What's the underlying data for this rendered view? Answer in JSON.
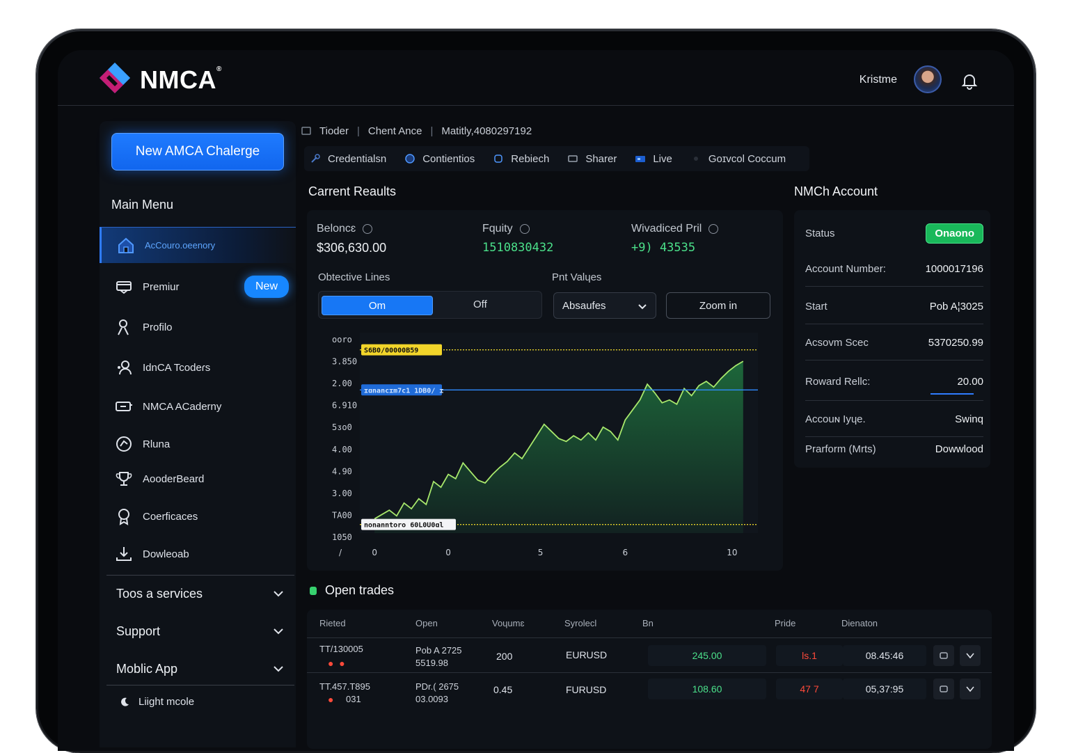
{
  "header": {
    "brand": "NMCA",
    "user_name": "Kristme"
  },
  "sidebar": {
    "new_button": "New AMCA Chalerge",
    "main_menu_title": "Main Menu",
    "items": [
      {
        "label": "AcCouro.oeenory",
        "icon": "home-icon"
      },
      {
        "label": "Premiur",
        "icon": "card-icon",
        "badge": "New"
      },
      {
        "label": "Profilo",
        "icon": "user-icon"
      },
      {
        "label": "IdnCA Tcodeɾs",
        "icon": "users-icon"
      },
      {
        "label": "NMCA ACaderny",
        "icon": "academy-icon"
      },
      {
        "label": "Rluna",
        "icon": "rules-icon"
      },
      {
        "label": "AooderBeard",
        "icon": "trophy-icon"
      },
      {
        "label": "Coerficaces",
        "icon": "certificate-icon"
      },
      {
        "label": "Dowleoab",
        "icon": "download-icon"
      }
    ],
    "sections": [
      "Toos a services",
      "Support",
      "Moblic App"
    ],
    "light_mode": "Liight mcole"
  },
  "breadcrumb": [
    "Tioder",
    "Chent Ance",
    "Matitly,4080297192"
  ],
  "tabs": [
    "Credentialsn",
    "Contientios",
    "Rebiech",
    "Sharer",
    "Live",
    "Goɪvcol Coccum"
  ],
  "results": {
    "title": "Carrent Reaults",
    "balance_label": "Beloncɛ",
    "balance_value": "$306,630.00",
    "equity_label": "Fquity",
    "equity_value": "1510830432",
    "unrealized_label": "Wivadiced Pril",
    "unrealized_value": "+9) 43535",
    "objective_label": "Obtective Lines",
    "toggle_on": "Om",
    "toggle_off": "Off",
    "pnt_label": "Pnt Valɥes",
    "select_value": "Absaufes",
    "zoom_label": "Zoom in"
  },
  "chart_data": {
    "type": "area",
    "title": "",
    "y_ticks": [
      "ooro",
      "3.850",
      "2.00",
      "6.910",
      "5ᴣo0",
      "4.00",
      "4.90",
      "3.00",
      "TA00",
      "1050"
    ],
    "x_ticks": [
      "0",
      "0",
      "5",
      "6",
      "10"
    ],
    "x_leading_label": "/",
    "x": [
      0,
      0.4,
      0.6,
      0.8,
      1.0,
      1.2,
      1.4,
      1.6,
      1.8,
      2.0,
      2.2,
      2.4,
      2.6,
      2.8,
      3.0,
      3.2,
      3.4,
      3.6,
      3.8,
      4.0,
      4.2,
      4.4,
      4.6,
      4.8,
      5.0,
      5.2,
      5.4,
      5.6,
      5.8,
      6.0,
      6.2,
      6.4,
      6.6,
      6.8,
      7.0,
      7.2,
      7.4,
      7.6,
      7.8,
      8.0,
      8.2,
      8.4,
      8.6,
      8.8,
      9.0,
      9.2,
      9.4,
      9.6,
      9.8,
      10.0
    ],
    "values": [
      1.0,
      1.6,
      1.2,
      2.1,
      1.7,
      2.4,
      2.0,
      3.6,
      3.2,
      4.1,
      3.8,
      4.9,
      4.3,
      3.7,
      3.5,
      4.1,
      4.6,
      5.0,
      5.6,
      5.2,
      6.0,
      6.8,
      7.6,
      7.1,
      6.6,
      6.4,
      6.8,
      6.5,
      7.0,
      6.5,
      7.4,
      7.1,
      6.5,
      7.9,
      8.6,
      9.3,
      10.4,
      9.8,
      9.1,
      9.3,
      9.0,
      10.1,
      9.6,
      10.3,
      10.6,
      10.2,
      10.8,
      11.3,
      11.7,
      12.0
    ],
    "y_range": [
      0,
      14
    ],
    "x_range": [
      -0.4,
      10.4
    ],
    "ref_lines": [
      {
        "value": 12.8,
        "color": "#e8d22a",
        "label": "S6B0/00000B59"
      },
      {
        "value": 10.0,
        "color": "#2f8cff",
        "label": "ɪɑnancɪm7c1 1DB0/ ɪ"
      },
      {
        "value": 0.6,
        "color": "#e8d22a",
        "label": "nonanntoro 60L0U0ɑl"
      }
    ],
    "line_color": "#a8e86c",
    "fill_color": "#1e6b3c"
  },
  "account": {
    "title": "NMCh Account",
    "rows": [
      {
        "label": "Status",
        "value": "Onaono",
        "pill": true
      },
      {
        "label": "Account Number:",
        "value": "1000017196"
      },
      {
        "label": "Start",
        "value": "Pob A¦3025"
      },
      {
        "label": "Acsovm Scec",
        "value": "5370250.99"
      },
      {
        "label": "Roward Rellc:",
        "value": "20.00"
      },
      {
        "label": "Accouɴ Iyɥe.",
        "value": "Swinq"
      },
      {
        "label": "Prarform (Mrts)",
        "value": "Dowwlood"
      }
    ]
  },
  "trades": {
    "title": "Open trades",
    "columns": [
      "Rieted",
      "Open",
      "Voɥumɛ",
      "Syrolecl",
      "Bn",
      "Pride",
      "Dienaton"
    ],
    "rows": [
      {
        "id": "TT/130005",
        "open1": "Pob A  2725",
        "open2": "5519.98",
        "volume": "200",
        "symbol": "EURUSD",
        "bn": "245.00",
        "price": "Ɩs.1",
        "duration": "08.45:46"
      },
      {
        "id": "TT.457.T895",
        "id2": "031",
        "open1": "PDr.( 2675",
        "open2": "03.0093",
        "volume": "0.45",
        "symbol": "FURUSD",
        "bn": "108.60",
        "price": "47 7",
        "duration": "05,37:95"
      }
    ]
  },
  "colors": {
    "accent": "#1777f5",
    "positive": "#4be08a",
    "background": "#0a0c10",
    "card": "#0e1218"
  }
}
